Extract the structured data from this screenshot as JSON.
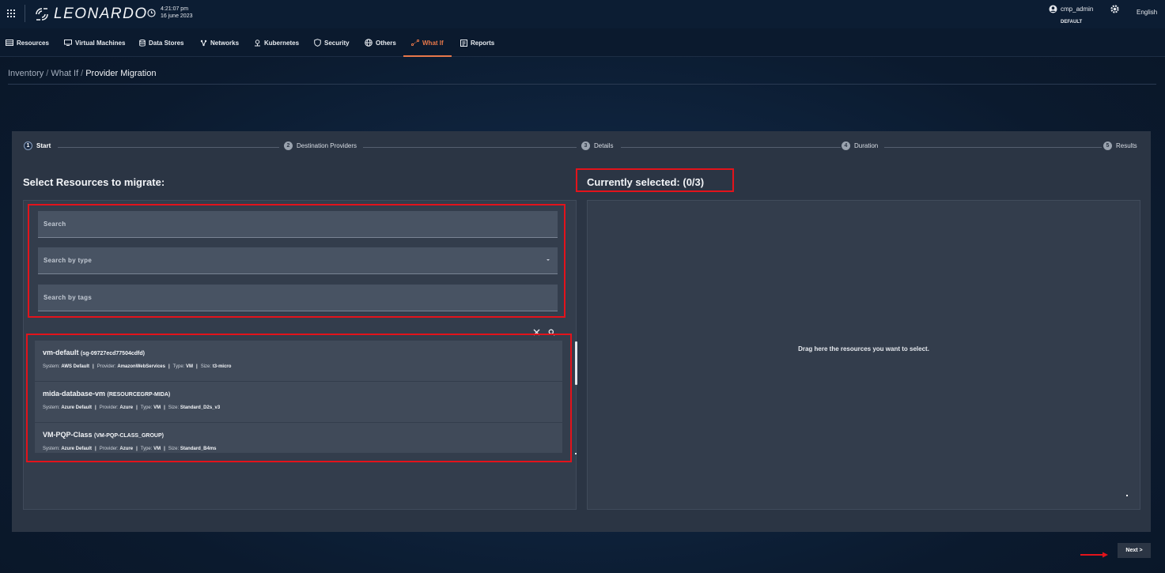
{
  "header": {
    "logo_text": "LEONARDO",
    "time": "4:21:07 pm",
    "date": "16 june 2023",
    "user_name": "cmp_admin",
    "tenant": "DEFAULT",
    "language": "English"
  },
  "nav": {
    "items": [
      {
        "label": "Resources",
        "icon": "server-rack-icon"
      },
      {
        "label": "Virtual Machines",
        "icon": "monitor-icon"
      },
      {
        "label": "Data Stores",
        "icon": "database-icon"
      },
      {
        "label": "Networks",
        "icon": "network-icon"
      },
      {
        "label": "Kubernetes",
        "icon": "kubernetes-icon"
      },
      {
        "label": "Security",
        "icon": "shield-icon"
      },
      {
        "label": "Others",
        "icon": "globe-icon"
      },
      {
        "label": "What If",
        "icon": "what-if-icon",
        "active": true
      },
      {
        "label": "Reports",
        "icon": "report-icon"
      }
    ],
    "active_color": "#e8784a"
  },
  "breadcrumb": {
    "items": [
      "Inventory",
      "What If"
    ],
    "current": "Provider Migration"
  },
  "stepper": {
    "steps": [
      {
        "num": "1",
        "label": "Start",
        "active": true
      },
      {
        "num": "2",
        "label": "Destination Providers"
      },
      {
        "num": "3",
        "label": "Details"
      },
      {
        "num": "4",
        "label": "Duration"
      },
      {
        "num": "5",
        "label": "Results"
      }
    ]
  },
  "left": {
    "title": "Select Resources to migrate:",
    "search_placeholder": "Search",
    "type_placeholder": "Search by type",
    "tags_placeholder": "Search by tags",
    "resources": [
      {
        "name": "vm-default",
        "group": "(sg-09727ecd77504cdfd)",
        "system_label": "System:",
        "system": "AWS Default",
        "provider_label": "Provider:",
        "provider": "AmazonWebServices",
        "type_label": "Type:",
        "type": "VM",
        "size_label": "Size:",
        "size": "t3-micro"
      },
      {
        "name": "mida-database-vm",
        "group": "(RESOURCEGRP-MIDA)",
        "system_label": "System:",
        "system": "Azure Default",
        "provider_label": "Provider:",
        "provider": "Azure",
        "type_label": "Type:",
        "type": "VM",
        "size_label": "Size:",
        "size": "Standard_D2s_v3"
      },
      {
        "name": "VM-PQP-Class",
        "group": "(VM-PQP-CLASS_GROUP)",
        "system_label": "System:",
        "system": "Azure Default",
        "provider_label": "Provider:",
        "provider": "Azure",
        "type_label": "Type:",
        "type": "VM",
        "size_label": "Size:",
        "size": "Standard_B4ms"
      }
    ]
  },
  "right": {
    "title": "Currently selected: (0/3)",
    "drop_text": "Drag here the resources you want to select."
  },
  "footer": {
    "next_label": "Next >"
  },
  "colors": {
    "highlight": "#e3131b",
    "panel": "#2b3544"
  }
}
